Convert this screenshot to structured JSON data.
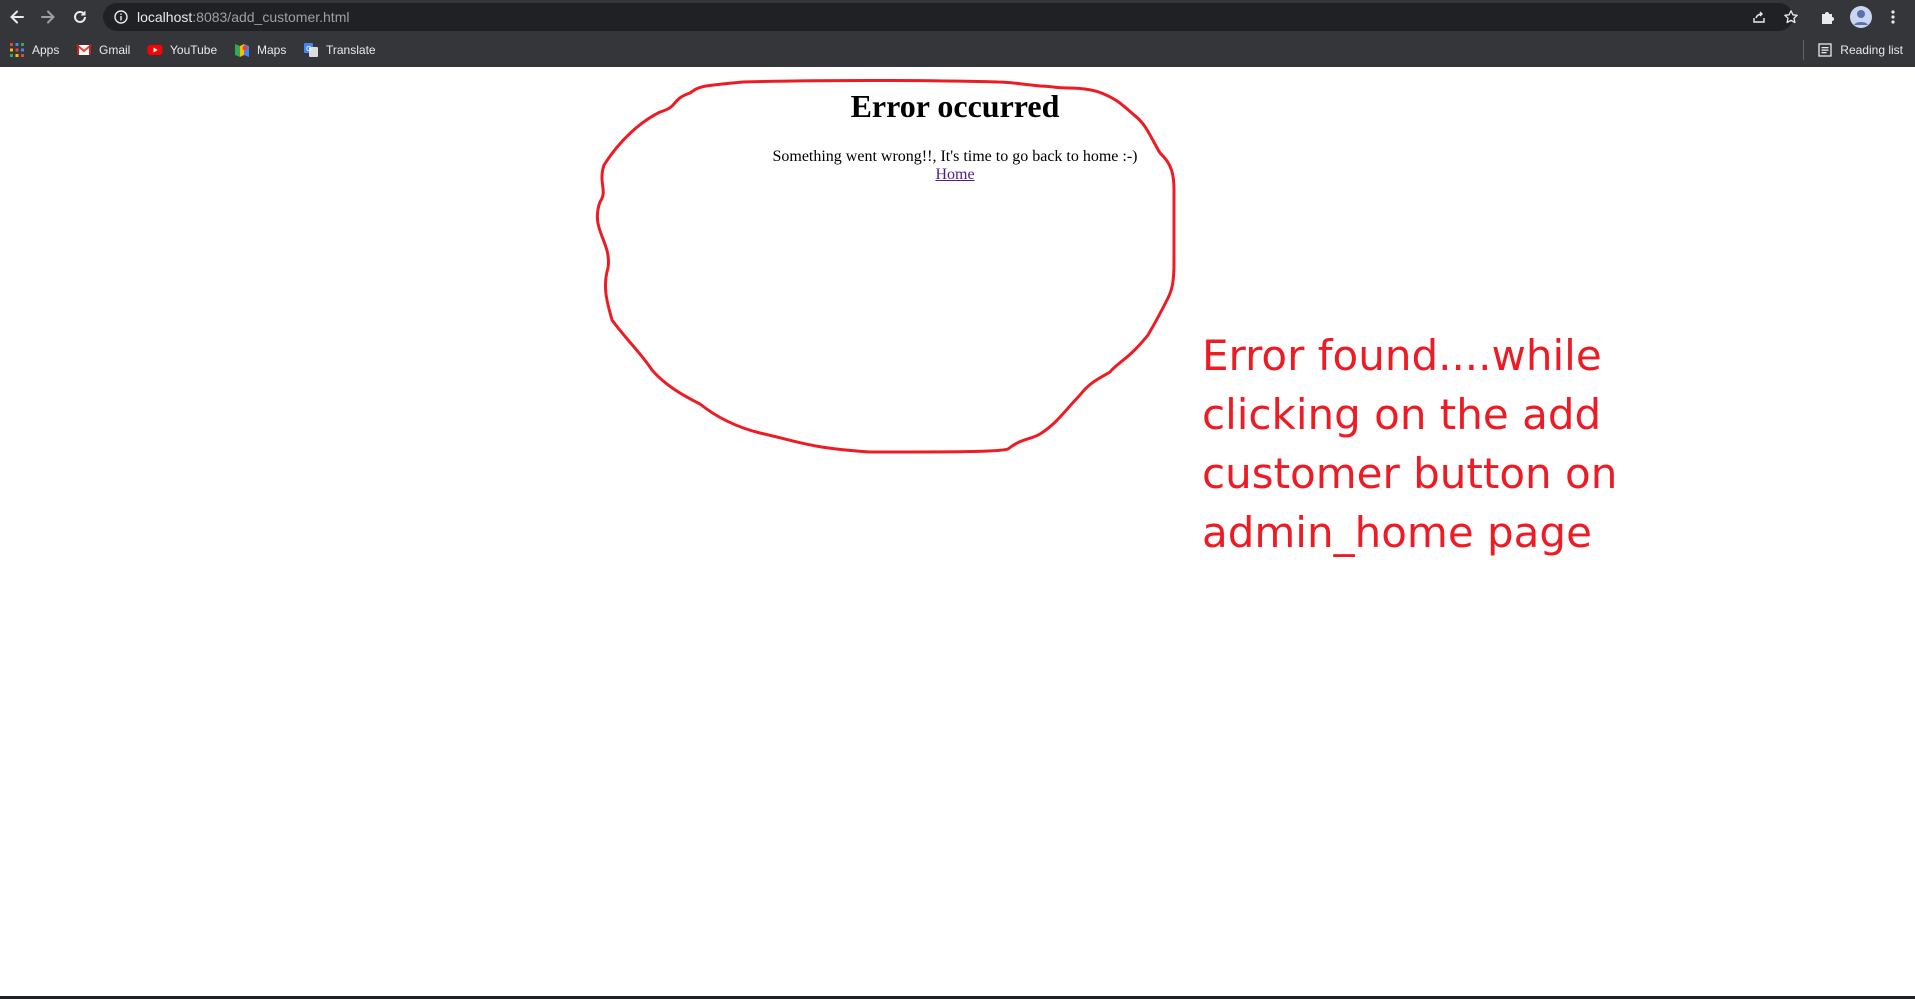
{
  "browser": {
    "url_host": "localhost",
    "url_rest": ":8083/add_customer.html",
    "icons": {
      "back": "back-arrow-icon",
      "forward": "forward-arrow-icon",
      "reload": "reload-icon",
      "site_info": "info-icon",
      "share": "share-icon",
      "bookmark": "star-icon",
      "extensions": "puzzle-icon",
      "profile": "avatar",
      "menu": "kebab-menu-icon"
    }
  },
  "bookmarks": [
    {
      "label": "Apps",
      "icon": "apps-grid-icon"
    },
    {
      "label": "Gmail",
      "icon": "gmail-icon"
    },
    {
      "label": "YouTube",
      "icon": "youtube-icon"
    },
    {
      "label": "Maps",
      "icon": "maps-icon"
    },
    {
      "label": "Translate",
      "icon": "translate-icon"
    }
  ],
  "reading_list": {
    "label": "Reading list",
    "icon": "reading-list-icon"
  },
  "page": {
    "title": "Error occurred",
    "message": "Something went wrong!!, It's time to go back to home :-)",
    "home_link": "Home"
  },
  "annotation": {
    "text": "Error found....while\nclicking on the add\ncustomer button on\nadmin_home page",
    "color": "#ed1c24"
  }
}
